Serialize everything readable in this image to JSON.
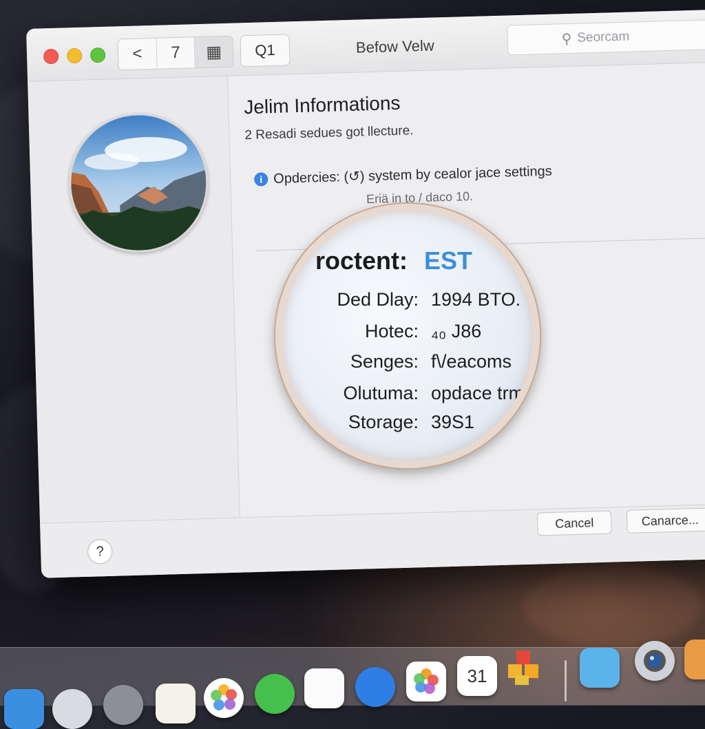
{
  "window": {
    "title": "Befow Velw",
    "toolbar": {
      "back_label": "<",
      "page_label": "7",
      "grid_label": "▦",
      "q_label": "Q1"
    },
    "search": {
      "placeholder": "Seorcam",
      "icon": "magnifier-icon"
    }
  },
  "content": {
    "title": "Jelim Informations",
    "subtitle": "2 Resadi sedues got llecture.",
    "notice": {
      "icon": "info-icon",
      "text": "Opdercies: (↺) system by cealor jace settings",
      "sub": "Eriä in to / daco 10."
    }
  },
  "magnifier": {
    "title": "roctent:",
    "title_value": "EST",
    "rows": [
      {
        "label": "Ded Dlay:",
        "value": "1994 BTO."
      },
      {
        "label": "Hotec:",
        "value": "₄₀ J86"
      },
      {
        "label": "Senges:",
        "value": "f\\/eacoms"
      },
      {
        "label": "Olutuma:",
        "value": "opdace trma"
      },
      {
        "label": "Storage:",
        "value": "39S1"
      }
    ]
  },
  "footer": {
    "help_label": "?",
    "cancel_label": "Cancel",
    "continue_label": "Canarce..."
  },
  "dock": {
    "items": [
      {
        "name": "safari",
        "icon": "compass-icon"
      },
      {
        "name": "settings",
        "icon": "gear-icon"
      },
      {
        "name": "notes",
        "icon": "notes-icon"
      },
      {
        "name": "photos",
        "icon": "photos-icon"
      },
      {
        "name": "messages",
        "icon": "chat-icon"
      },
      {
        "name": "reminders",
        "icon": "list-icon"
      },
      {
        "name": "appstore",
        "icon": "app-store-icon"
      },
      {
        "name": "photos-2",
        "icon": "flower-icon"
      },
      {
        "name": "calendar",
        "icon": "calendar-icon",
        "label": "31"
      },
      {
        "name": "blocks",
        "icon": "cubes-icon"
      },
      {
        "name": "folder",
        "icon": "folder-icon"
      },
      {
        "name": "camera",
        "icon": "camera-icon"
      },
      {
        "name": "extra",
        "icon": "app-icon"
      }
    ]
  },
  "colors": {
    "accent": "#3d8fd9",
    "close": "#f15c55",
    "minimize": "#f6bc2f",
    "maximize": "#5fc53d"
  }
}
